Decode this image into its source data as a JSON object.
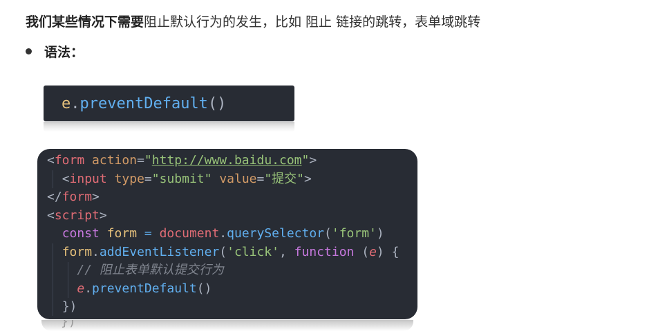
{
  "intro": {
    "bold": "我们某些情况下需要",
    "rest": "阻止默认行为的发生，比如 阻止 链接的跳转，表单域跳转"
  },
  "bullet": {
    "label": "语法："
  },
  "code_small": {
    "obj": "e",
    "dot": ".",
    "method": "preventDefault",
    "parens": "()"
  },
  "code_big": {
    "l1": {
      "open": "<",
      "tag": "form",
      "sp": " ",
      "attr": "action",
      "eq": "=",
      "q1": "\"",
      "url": "http://www.baidu.com",
      "q2": "\"",
      "close": ">"
    },
    "l2": {
      "indent": "  ",
      "open": "<",
      "tag": "input",
      "sp": " ",
      "attr1": "type",
      "eq1": "=",
      "val1": "\"submit\"",
      "sp2": " ",
      "attr2": "value",
      "eq2": "=",
      "val2": "\"提交\"",
      "close": ">"
    },
    "l3": {
      "open": "</",
      "tag": "form",
      "close": ">"
    },
    "l4": {
      "open": "<",
      "tag": "script",
      "close": ">"
    },
    "l5": {
      "indent": "  ",
      "kw": "const",
      "sp": " ",
      "var": "form",
      "op": " = ",
      "obj": "document",
      "dot": ".",
      "fn": "querySelector",
      "p1": "(",
      "str": "'form'",
      "p2": ")"
    },
    "l6": {
      "indent": "  ",
      "var": "form",
      "dot": ".",
      "fn": "addEventListener",
      "p1": "(",
      "str": "'click'",
      "comma": ", ",
      "kw": "function",
      "sp": " ",
      "p2": "(",
      "param": "e",
      "p3": ")",
      "brace": " {"
    },
    "l7": {
      "indent": "    ",
      "comment": "// 阻止表单默认提交行为"
    },
    "l8": {
      "indent": "    ",
      "param": "e",
      "dot": ".",
      "fn": "preventDefault",
      "parens": "()"
    },
    "l9": {
      "indent": "  ",
      "close": "})"
    },
    "reflection": "})"
  },
  "colors": {
    "code_bg": "#282c34",
    "tag": "#e06c75",
    "attr": "#d19a66",
    "string": "#98c379",
    "keyword": "#c678dd",
    "variable": "#e5c07b",
    "function": "#61afef",
    "comment": "#7f848e",
    "punctuation": "#abb2bf"
  }
}
